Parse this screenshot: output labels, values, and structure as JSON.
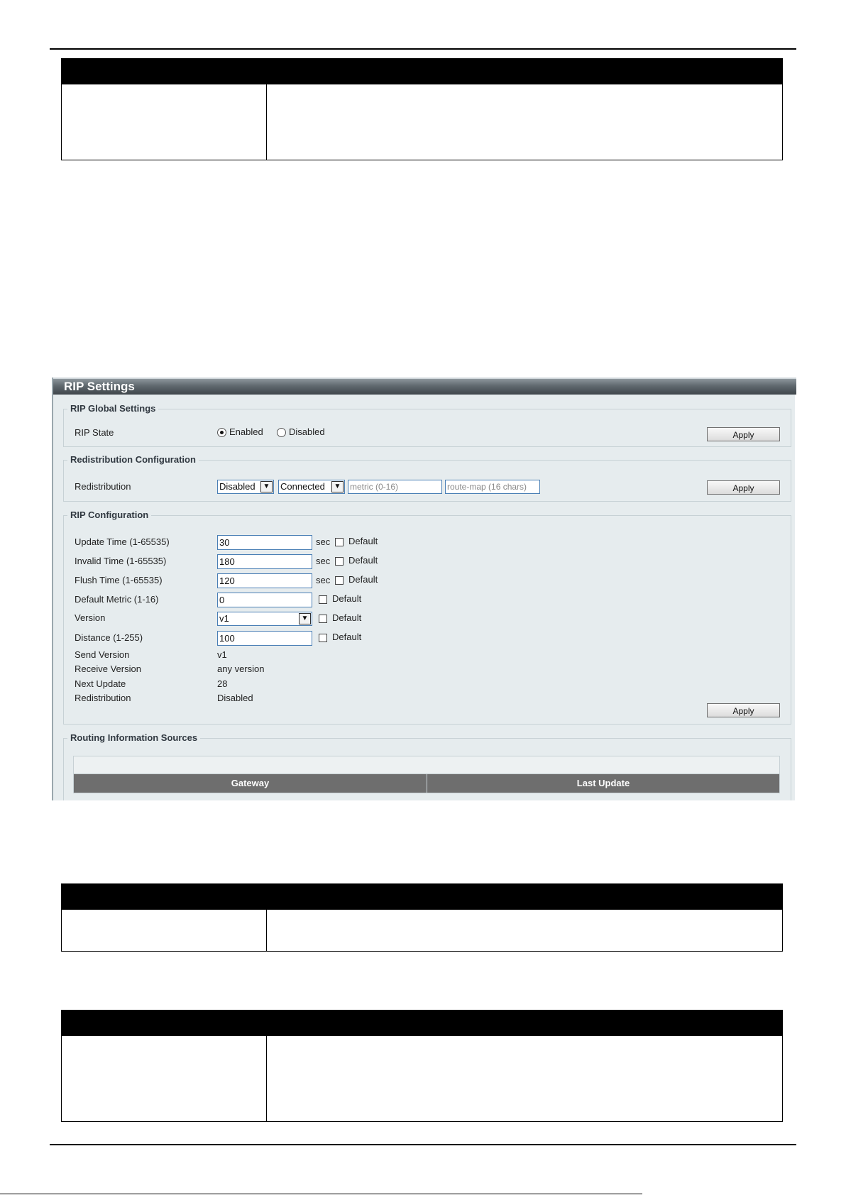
{
  "rip_settings": {
    "title": "RIP Settings",
    "global": {
      "legend": "RIP Global Settings",
      "state_label": "RIP State",
      "option_enabled": "Enabled",
      "option_disabled": "Disabled",
      "selected": "Enabled",
      "apply_label": "Apply"
    },
    "redistribution": {
      "legend": "Redistribution Configuration",
      "label": "Redistribution",
      "state_value": "Disabled",
      "type_value": "Connected",
      "metric_placeholder": "metric (0-16)",
      "route_map_placeholder": "route-map (16 chars)",
      "apply_label": "Apply"
    },
    "config": {
      "legend": "RIP Configuration",
      "sec_unit": "sec",
      "default_label": "Default",
      "update_time": {
        "label": "Update Time (1-65535)",
        "value": "30"
      },
      "invalid_time": {
        "label": "Invalid Time (1-65535)",
        "value": "180"
      },
      "flush_time": {
        "label": "Flush Time (1-65535)",
        "value": "120"
      },
      "default_metric": {
        "label": "Default Metric (1-16)",
        "value": "0"
      },
      "version": {
        "label": "Version",
        "value": "v1"
      },
      "distance": {
        "label": "Distance (1-255)",
        "value": "100"
      },
      "send_version": {
        "label": "Send Version",
        "value": "v1"
      },
      "receive_version": {
        "label": "Receive Version",
        "value": "any version"
      },
      "next_update": {
        "label": "Next Update",
        "value": "28"
      },
      "redistribution": {
        "label": "Redistribution",
        "value": "Disabled"
      },
      "apply_label": "Apply"
    },
    "sources": {
      "legend": "Routing Information Sources",
      "columns": [
        "Gateway",
        "Last Update"
      ]
    }
  }
}
